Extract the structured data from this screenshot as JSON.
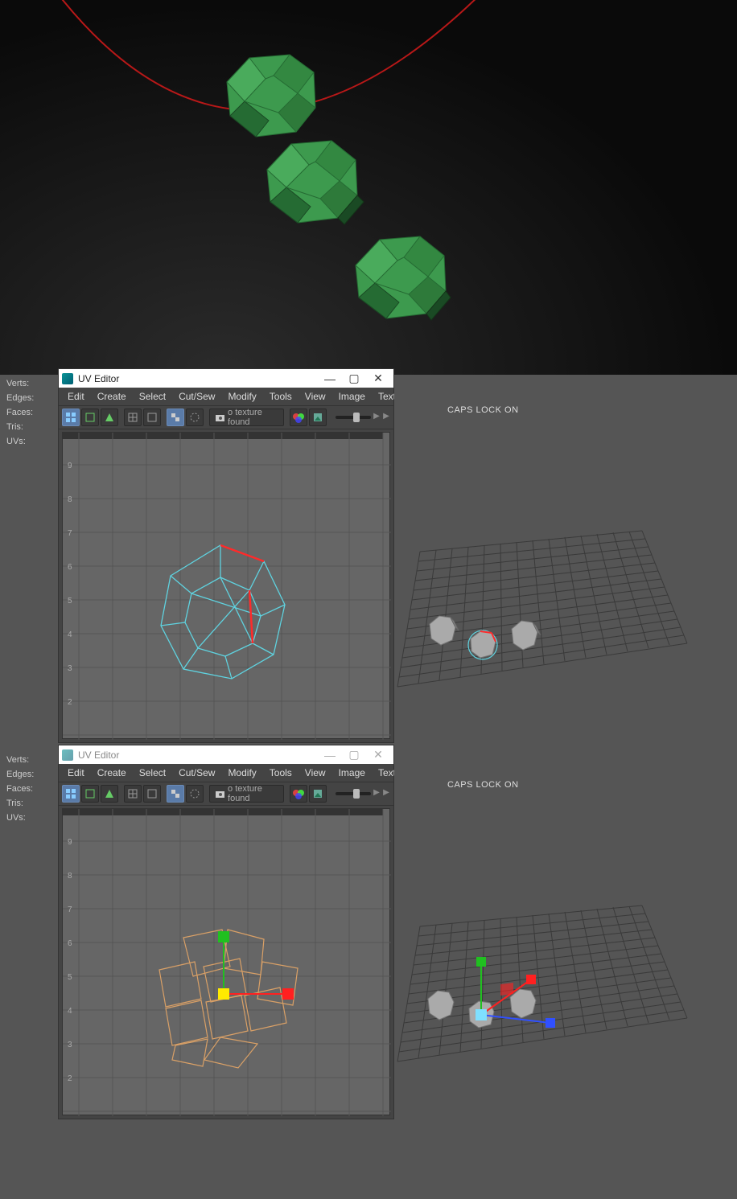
{
  "stats_labels": {
    "verts": "Verts:",
    "edges": "Edges:",
    "faces": "Faces:",
    "tris": "Tris:",
    "uvs": "UVs:"
  },
  "uv_editor": {
    "title": "UV Editor",
    "menu": {
      "edit": "Edit",
      "create": "Create",
      "select": "Select",
      "cutsew": "Cut/Sew",
      "modify": "Modify",
      "tools": "Tools",
      "view": "View",
      "image": "Image",
      "textures": "Textures",
      "more": "»"
    },
    "toolbar": {
      "texture_status": "o texture found",
      "rgb_icon": "RGB"
    },
    "axis_ticks": {
      "y": [
        "9",
        "8",
        "7",
        "6",
        "5",
        "4",
        "3",
        "2"
      ]
    }
  },
  "win_buttons": {
    "min": "—",
    "max": "▢",
    "close": "✕"
  },
  "right_viewport": {
    "caps_lock": "CAPS LOCK ON"
  },
  "colors": {
    "green_shape": "#3d9a4e",
    "green_shape_dark": "#2a6b35",
    "red_curve": "#b81818",
    "uv_wire_cyan": "#5fd3e0",
    "uv_wire_red": "#ff2a2a",
    "uv_wire_orange": "#d9a066",
    "grid_dark": "#3a3a3a",
    "manipulator_red": "#ff2020",
    "manipulator_green": "#20c020",
    "manipulator_blue": "#3050ff",
    "manipulator_yellow": "#ffea00",
    "manipulator_cyan": "#7fe0ff"
  }
}
